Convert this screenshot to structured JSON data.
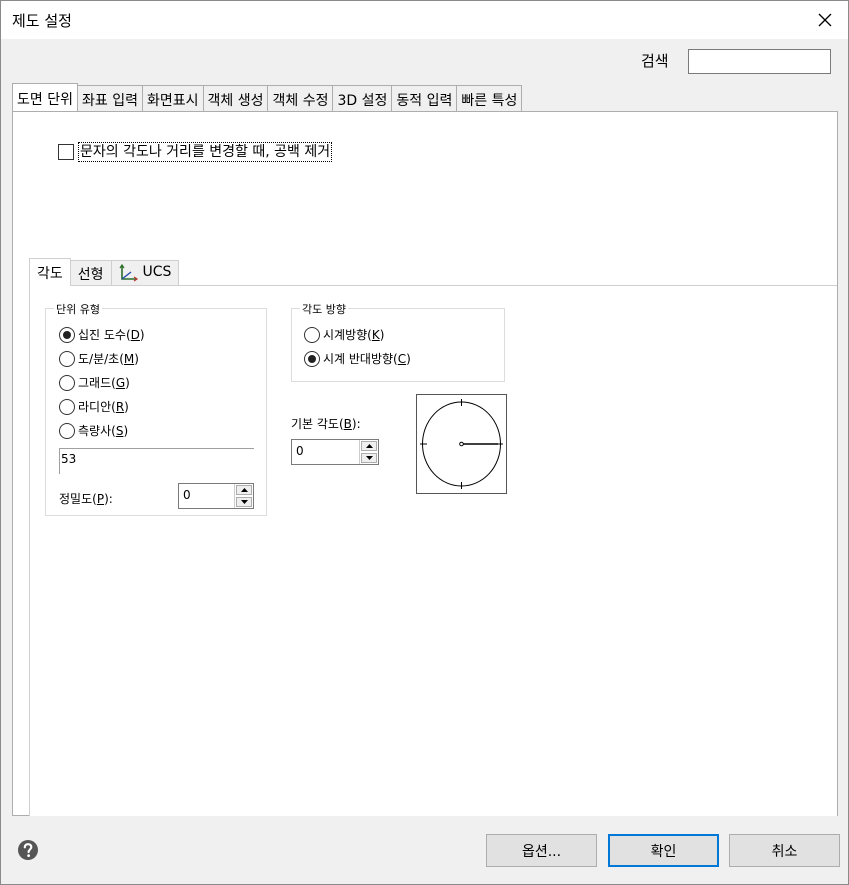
{
  "window": {
    "title": "제도 설정"
  },
  "search": {
    "label": "검색",
    "value": ""
  },
  "main_tabs": [
    {
      "label": "도면 단위",
      "active": true
    },
    {
      "label": "좌표 입력"
    },
    {
      "label": "화면표시"
    },
    {
      "label": "객체 생성"
    },
    {
      "label": "객체 수정"
    },
    {
      "label": "3D 설정"
    },
    {
      "label": "동적 입력"
    },
    {
      "label": "빠른 특성"
    }
  ],
  "option_checkbox": {
    "label": "문자의 각도나 거리를 변경할 때, 공백 제거",
    "checked": false
  },
  "sub_tabs": [
    {
      "label": "각도",
      "active": true
    },
    {
      "label": "선형"
    },
    {
      "label": "UCS",
      "icon": "ucs-axes-icon"
    }
  ],
  "unit_type": {
    "legend": "단위 유형",
    "options": [
      {
        "pre": "십진 도수(",
        "key": "D",
        "post": ")",
        "checked": true
      },
      {
        "pre": "도/분/초(",
        "key": "M",
        "post": ")",
        "checked": false
      },
      {
        "pre": "그래드(",
        "key": "G",
        "post": ")",
        "checked": false
      },
      {
        "pre": "라디안(",
        "key": "R",
        "post": ")",
        "checked": false
      },
      {
        "pre": "측량사(",
        "key": "S",
        "post": ")",
        "checked": false
      }
    ],
    "preview_value": "53",
    "precision_label_pre": "정밀도(",
    "precision_key": "P",
    "precision_label_post": "):",
    "precision_value": "0"
  },
  "angle_direction": {
    "legend": "각도 방향",
    "options": [
      {
        "pre": "시계방향(",
        "key": "K",
        "post": ")",
        "checked": false
      },
      {
        "pre": "시계 반대방향(",
        "key": "C",
        "post": ")",
        "checked": true
      }
    ]
  },
  "base_angle": {
    "label_pre": "기본 각도(",
    "key": "B",
    "label_post": "):",
    "value": "0"
  },
  "footer": {
    "options_label": "옵션...",
    "ok_label": "확인",
    "cancel_label": "취소"
  },
  "colors": {
    "accent": "#0078d7",
    "help_icon": "#555555"
  }
}
